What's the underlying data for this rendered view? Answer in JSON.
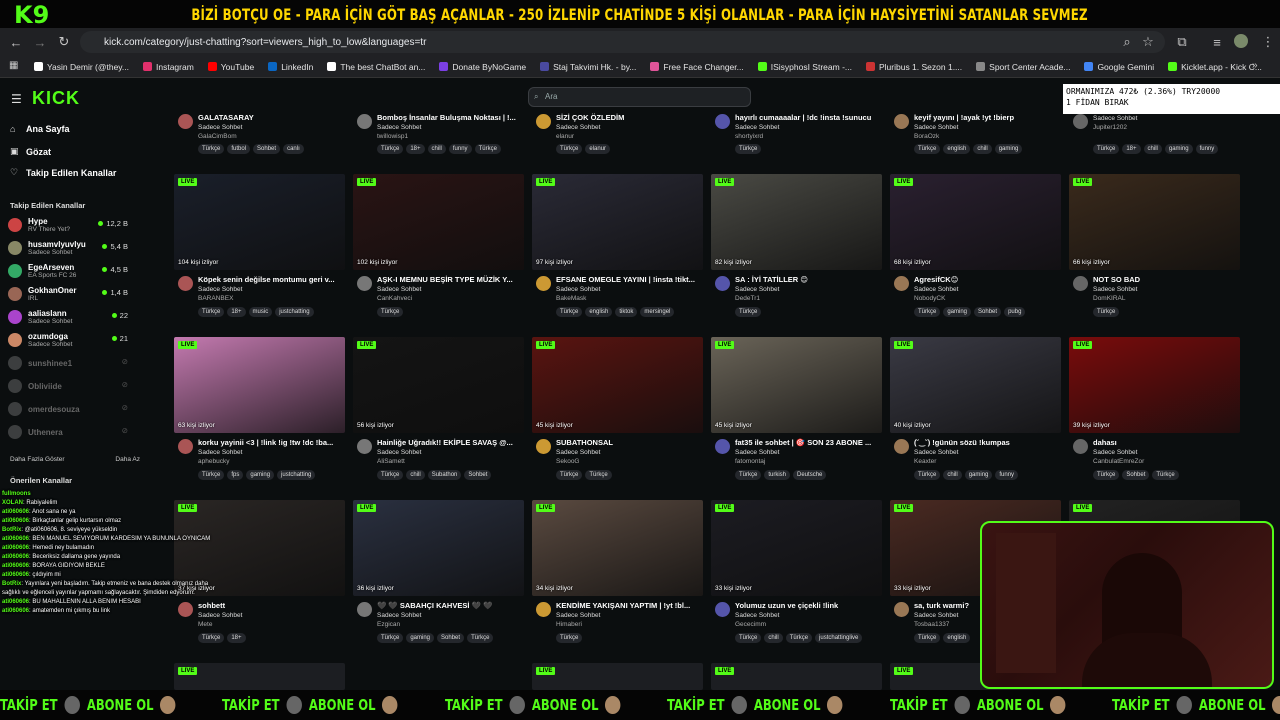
{
  "banner": {
    "logo": "9",
    "text": "BİZİ BOTÇU OE - PARA İÇİN GÖT BAŞ AÇANLAR - 250 İZLENİP CHATİNDE 5 KİŞİ OLANLAR - PARA İÇİN HAYSİYETİNİ SATANLAR SEVMEZ"
  },
  "browser": {
    "url": "kick.com/category/just-chatting?sort=viewers_high_to_low&languages=tr"
  },
  "bookmarks": [
    {
      "label": "Yasin Demir (@they...",
      "color": "#ffffff"
    },
    {
      "label": "Instagram",
      "color": "#e1306c"
    },
    {
      "label": "YouTube",
      "color": "#ff0000"
    },
    {
      "label": "LinkedIn",
      "color": "#0a66c2"
    },
    {
      "label": "The best ChatBot an...",
      "color": "#ffffff"
    },
    {
      "label": "Donate ByNoGame",
      "color": "#7b3fe4"
    },
    {
      "label": "Staj Takvimi Hk. - by...",
      "color": "#4a4aa0"
    },
    {
      "label": "Free Face Changer...",
      "color": "#e05599"
    },
    {
      "label": "ISisyphosI Stream -...",
      "color": "#53fc18"
    },
    {
      "label": "Pluribus 1. Sezon 1....",
      "color": "#cc3333"
    },
    {
      "label": "Sport Center Acade...",
      "color": "#888888"
    },
    {
      "label": "Google Gemini",
      "color": "#4285f4"
    },
    {
      "label": "Kicklet.app - Kick C...",
      "color": "#53fc18"
    }
  ],
  "sidebar": {
    "logo": "KICK",
    "nav": [
      "Ana Sayfa",
      "Gözat",
      "Takip Edilen Kanallar"
    ],
    "followed_title": "Takip Edilen Kanallar",
    "followed": [
      {
        "name": "Hype",
        "sub": "RV There Yet?",
        "viewers": "12,2 B",
        "online": true,
        "color": "#c44"
      },
      {
        "name": "husamvlyuvlyu",
        "sub": "Sadece Sohbet",
        "viewers": "5,4 B",
        "online": true,
        "color": "#886"
      },
      {
        "name": "EgeArseven",
        "sub": "EA Sports FC 26",
        "viewers": "4,5 B",
        "online": true,
        "color": "#3a6"
      },
      {
        "name": "GokhanOner",
        "sub": "IRL",
        "viewers": "1,4 B",
        "online": true,
        "color": "#965"
      },
      {
        "name": "aaliaslann",
        "sub": "Sadece Sohbet",
        "viewers": "22",
        "online": true,
        "color": "#a4c"
      },
      {
        "name": "ozumdoga",
        "sub": "Sadece Sohbet",
        "viewers": "21",
        "online": true,
        "color": "#c86"
      },
      {
        "name": "sunshinee1",
        "sub": "",
        "viewers": "",
        "online": false,
        "color": "#888"
      },
      {
        "name": "Obliviide",
        "sub": "",
        "viewers": "",
        "online": false,
        "color": "#888"
      },
      {
        "name": "omerdesouza",
        "sub": "",
        "viewers": "",
        "online": false,
        "color": "#888"
      },
      {
        "name": "Uthenera",
        "sub": "",
        "viewers": "",
        "online": false,
        "color": "#888"
      }
    ],
    "more": "Daha Fazla Göster",
    "less": "Daha Az",
    "recommended_title": "Önerilen Kanallar"
  },
  "search": {
    "placeholder": "Ara"
  },
  "ticker": {
    "line1": "ORMANIMIZA  472₺ (2.36%)   TRY20000",
    "line2": "1 FİDAN BIRAK"
  },
  "top_row": [
    {
      "title": "GALATASARAY",
      "category": "Sadece Sohbet",
      "channel": "GalaCimBom",
      "tags": [
        "Türkçe",
        "futbol",
        "Sohbet",
        "canlı"
      ]
    },
    {
      "title": "Bomboş İnsanlar Buluşma Noktası | !...",
      "category": "Sadece Sohbet",
      "channel": "twillowisp1",
      "tags": [
        "Türkçe",
        "18+",
        "chill",
        "funny",
        "Türkçe"
      ]
    },
    {
      "title": "SİZİ ÇOK ÖZLEDİM",
      "category": "Sadece Sohbet",
      "channel": "elanur",
      "tags": [
        "Türkçe",
        "elanur"
      ]
    },
    {
      "title": "hayırlı cumaaaalar | !dc !insta !sunucu",
      "category": "Sadece Sohbet",
      "channel": "shortyixrd",
      "tags": [
        "Türkçe"
      ]
    },
    {
      "title": "keyif yayını | !ayak !yt !bierp",
      "category": "Sadece Sohbet",
      "channel": "BoraOzk",
      "tags": [
        "Türkçe",
        "english",
        "chill",
        "gaming"
      ]
    },
    {
      "title": "",
      "category": "Sadece Sohbet",
      "channel": "Jupiter1202",
      "tags": [
        "Türkçe",
        "18+",
        "chill",
        "gaming",
        "funny"
      ]
    }
  ],
  "streams": [
    {
      "viewers": "104 kişi izliyor",
      "title": "Köpek senin değilse montumu geri v...",
      "category": "Sadece Sohbet",
      "channel": "BARANBEX",
      "tags": [
        "Türkçe",
        "18+",
        "music",
        "justchatting"
      ],
      "bg": "#1a1f2a"
    },
    {
      "viewers": "102 kişi izliyor",
      "title": "AŞK-I MEMNU BEŞİR TYPE MÜZİK Y...",
      "category": "Sadece Sohbet",
      "channel": "CanKahveci",
      "tags": [
        "Türkçe"
      ],
      "bg": "#2a1414"
    },
    {
      "viewers": "97 kişi izliyor",
      "title": "EFSANE OMEGLE YAYINI | !insta !tikt...",
      "category": "Sadece Sohbet",
      "channel": "BakeMask",
      "tags": [
        "Türkçe",
        "english",
        "tiktok",
        "mersingel"
      ],
      "bg": "#2a2a36"
    },
    {
      "viewers": "82 kişi izliyor",
      "title": "SA : İYİ TATİLLER 😊",
      "category": "Sadece Sohbet",
      "channel": "DedeTr1",
      "tags": [
        "Türkçe"
      ],
      "bg": "#4a4a44"
    },
    {
      "viewers": "68 kişi izliyor",
      "title": "AgresifCK😊",
      "category": "Sadece Sohbet",
      "channel": "NobodyCK",
      "tags": [
        "Türkçe",
        "gaming",
        "Sohbet",
        "pubg"
      ],
      "bg": "#2a2030"
    },
    {
      "viewers": "66 kişi izliyor",
      "title": "NOT SO BAD",
      "category": "Sadece Sohbet",
      "channel": "DomKIRAL",
      "tags": [
        "Türkçe"
      ],
      "bg": "#3a2a1c"
    },
    {
      "viewers": "63 kişi izliyor",
      "title": "korku yayinii <3 | !link !ig !tw !dc !ba...",
      "category": "Sadece Sohbet",
      "channel": "aphebucky",
      "tags": [
        "Türkçe",
        "fps",
        "gaming",
        "justchatting"
      ],
      "bg": "#c47ab0"
    },
    {
      "viewers": "56 kişi izliyor",
      "title": "Hainliğe Uğradık!! EKİPLE SAVAŞ @...",
      "category": "Sadece Sohbet",
      "channel": "AliSamett",
      "tags": [
        "Türkçe",
        "chill",
        "Subathon",
        "Sohbet"
      ],
      "bg": "#141414"
    },
    {
      "viewers": "45 kişi izliyor",
      "title": "SUBATHONSAL",
      "category": "Sadece Sohbet",
      "channel": "SekooG",
      "tags": [
        "Türkçe",
        "Türkçe"
      ],
      "bg": "#5a1410"
    },
    {
      "viewers": "45 kişi izliyor",
      "title": "fat35 ile sohbet | 🎯 SON 23 ABONE ...",
      "category": "Sadece Sohbet",
      "channel": "fatomontaj",
      "tags": [
        "Türkçe",
        "turkish",
        "Deutsche"
      ],
      "bg": "#6a6458"
    },
    {
      "viewers": "40 kişi izliyor",
      "title": "(˘‿˘) !günün sözü !kumpas",
      "category": "Sadece Sohbet",
      "channel": "Keaxter",
      "tags": [
        "Türkçe",
        "chill",
        "gaming",
        "funny"
      ],
      "bg": "#3a3a44"
    },
    {
      "viewers": "39 kişi izliyor",
      "title": "dahası",
      "category": "Sadece Sohbet",
      "channel": "CanbulatEmreZor",
      "tags": [
        "Türkçe",
        "Sohbet",
        "Türkçe"
      ],
      "bg": "#7a0c0c"
    },
    {
      "viewers": "37 kişi izliyor",
      "title": "sohbett",
      "category": "Sadece Sohbet",
      "channel": "Mete",
      "tags": [
        "Türkçe",
        "18+"
      ],
      "bg": "#2a2624"
    },
    {
      "viewers": "36 kişi izliyor",
      "title": "🖤 🖤 SABAHÇI KAHVESİ 🖤 🖤",
      "category": "Sadece Sohbet",
      "channel": "Ezgican",
      "tags": [
        "Türkçe",
        "gaming",
        "Sohbet",
        "Türkçe"
      ],
      "bg": "#2a3040"
    },
    {
      "viewers": "34 kişi izliyor",
      "title": "KENDİME YAKIŞANI YAPTIM | !yt !bl...",
      "category": "Sadece Sohbet",
      "channel": "Himaberi",
      "tags": [
        "Türkçe"
      ],
      "bg": "#5a4a40"
    },
    {
      "viewers": "33 kişi izliyor",
      "title": "Yolumuz uzun ve çiçekli !link",
      "category": "Sadece Sohbet",
      "channel": "Gececimm",
      "tags": [
        "Türkçe",
        "chill",
        "Türkçe",
        "justchattinglive"
      ],
      "bg": "#1c1c22"
    },
    {
      "viewers": "33 kişi izliyor",
      "title": "sa, turk warmi?",
      "category": "Sadece Sohbet",
      "channel": "Tosbaa1337",
      "tags": [
        "Türkçe",
        "english"
      ],
      "bg": "#4a2a22"
    },
    {
      "viewers": "",
      "title": "",
      "category": "",
      "channel": "",
      "tags": [],
      "bg": "#222"
    }
  ],
  "live_label": "LIVE",
  "chat": [
    {
      "user": "fullmoons",
      "msg": ""
    },
    {
      "user": "XOLAN",
      "msg": ": Rabiyalelim"
    },
    {
      "user": "ati060606",
      "msg": ": Anot sana ne ya"
    },
    {
      "user": "ati060606",
      "msg": ": Birkaçtanlar gelip kurtarsın olmaz"
    },
    {
      "user": "BotRix",
      "msg": ": @ati060606, 8. seviyeye yükseldin"
    },
    {
      "user": "ati060606",
      "msg": ": BEN MANUEL SEVIYORUM KARDESIM YA BUNUNLA OYNICAM"
    },
    {
      "user": "ati060606",
      "msg": ": Hemedi ney bulamadın"
    },
    {
      "user": "ati060606",
      "msg": ": Beceriksiz dallama gene yayında"
    },
    {
      "user": "ati060606",
      "msg": ": BORAYA GIDIYOM BEKLE"
    },
    {
      "user": "ati060606",
      "msg": ": çıldıyim mi"
    },
    {
      "user": "BotRix",
      "msg": ": Yayınlara yeni başladım. Takip etmeniz ve bana destek olmanız daha sağlıklı ve eğlenceli yayınlar yapmamı sağlayacaktır. Şimdiden edyorum."
    },
    {
      "user": "ati060606",
      "msg": ": BU MAHALLENIN ALLA BENIM HESABI"
    },
    {
      "user": "ati060606",
      "msg": ": amatemden mi çıkmış bu link"
    }
  ],
  "footer": {
    "follow": "TAKİP ET",
    "subscribe": "ABONE OL"
  }
}
